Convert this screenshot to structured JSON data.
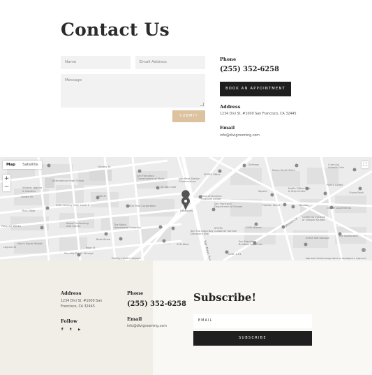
{
  "contact": {
    "title": "Contact Us",
    "name_placeholder": "Name",
    "email_placeholder": "Email Address",
    "message_placeholder": "Message",
    "submit_label": "SUBMIT",
    "phone_label": "Phone",
    "phone_value": "(255) 352-6258",
    "book_label": "BOOK AN APPOINTMENT",
    "address_label": "Address",
    "address_value": "1234 Divi St. #1000 San Francisco, CA 32445",
    "email_label": "Email",
    "email_value": "info@divigrooming.com"
  },
  "map": {
    "map_tab": "Map",
    "satellite_tab": "Satellite",
    "zoom_in": "+",
    "zoom_out": "−",
    "attribution": "Map data ©2023 Google   Terms of Use   Report a map error",
    "labels": [
      "International High School",
      "Hickory St",
      "Victoria Laguna & Gardens",
      "Oak St",
      "Fell St",
      "Page St",
      "Laguna St",
      "Linden St",
      "Octavia Blvd",
      "Hayes St",
      "Grove St",
      "Ivy St",
      "Rich Table",
      "Alamo Square",
      "Patty Art Works",
      "Nick's Super Market",
      "Security Public Storage",
      "San Francisco Conservatory of Music",
      "Van Ness Station",
      "Star Park Corporation",
      "Bank of America Financial Center",
      "San Francisco Department of Human",
      "Deseparts",
      "SFMTA Customer Service",
      "SVN West",
      "1500 Mission",
      "San Francisco Building Inspection",
      "San Francisco Bay Discovery Site",
      "Flatiron Shopping",
      "Flatiron Street",
      "Nema South Ninth",
      "FedEx Office Print & Ship Center",
      "Peet's Coffee",
      "OLUME Apartments",
      "California Institute of Integral Studies",
      "SOMA Self-Storage",
      "The Sutherland",
      "Cumulus Artwalk Cafe",
      "Chase Bank",
      "Mission St",
      "Van Ness Ave",
      "SFMTA Office",
      "All Star Cafe",
      "The Salon Homemade Company",
      "Kaiser Performing Arts Center",
      "Bella Shine",
      "Market St",
      "Dignity Health Hospital",
      "CCSF 2.01",
      "Vista Blocks",
      "Safeway",
      "Level 1"
    ]
  },
  "footer": {
    "address_label": "Address",
    "address_value": "1234 Divi St. #1000 San Francisco, CA 32445",
    "follow_label": "Follow",
    "social_icons": [
      "facebook-icon",
      "twitter-icon",
      "youtube-icon"
    ],
    "social_glyphs": [
      "f",
      "t",
      "▶"
    ],
    "phone_label": "Phone",
    "phone_value": "(255) 352-6258",
    "email_label": "Email",
    "email_value": "info@divigrooming.com",
    "subscribe_title": "Subscribe!",
    "email_placeholder": "EMAIL",
    "subscribe_label": "SUBSCRIBE"
  },
  "colors": {
    "accent": "#dcc29f",
    "dark": "#1f1f1f",
    "footer_left_bg": "#f1eee8",
    "footer_right_bg": "#faf8f5"
  }
}
